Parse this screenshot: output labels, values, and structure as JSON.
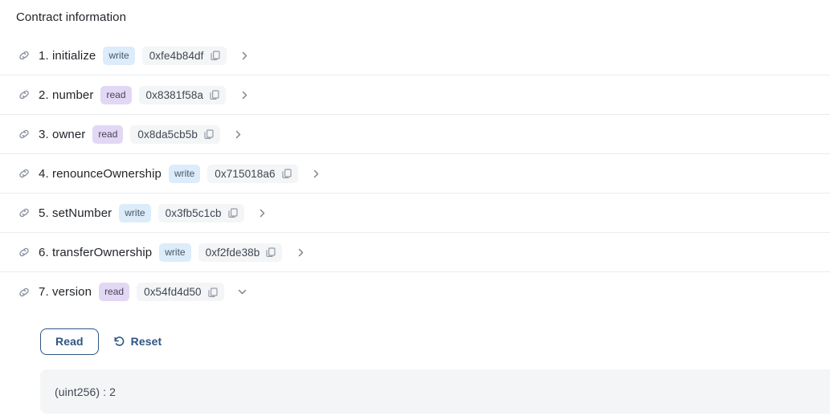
{
  "panel": {
    "title": "Contract information"
  },
  "icons": {
    "link": "link-icon",
    "copy": "copy-icon",
    "chevron_right": "chevron-right-icon",
    "chevron_down": "chevron-down-icon",
    "reset": "undo-icon"
  },
  "colors": {
    "badge_write_bg": "#dcecfa",
    "badge_read_bg": "#e2d8f5",
    "chip_bg": "#f4f5f6",
    "accent": "#2f5584",
    "divider": "#e9ecef",
    "text": "#1f2329"
  },
  "functions": [
    {
      "index": "1.",
      "name": "initialize",
      "mutability": "write",
      "selector": "0xfe4b84df",
      "expanded": false
    },
    {
      "index": "2.",
      "name": "number",
      "mutability": "read",
      "selector": "0x8381f58a",
      "expanded": false
    },
    {
      "index": "3.",
      "name": "owner",
      "mutability": "read",
      "selector": "0x8da5cb5b",
      "expanded": false
    },
    {
      "index": "4.",
      "name": "renounceOwnership",
      "mutability": "write",
      "selector": "0x715018a6",
      "expanded": false
    },
    {
      "index": "5.",
      "name": "setNumber",
      "mutability": "write",
      "selector": "0x3fb5c1cb",
      "expanded": false
    },
    {
      "index": "6.",
      "name": "transferOwnership",
      "mutability": "write",
      "selector": "0xf2fde38b",
      "expanded": false
    },
    {
      "index": "7.",
      "name": "version",
      "mutability": "read",
      "selector": "0x54fd4d50",
      "expanded": true
    }
  ],
  "expanded_panel": {
    "read_button_label": "Read",
    "reset_button_label": "Reset",
    "result": "(uint256) : 2"
  }
}
